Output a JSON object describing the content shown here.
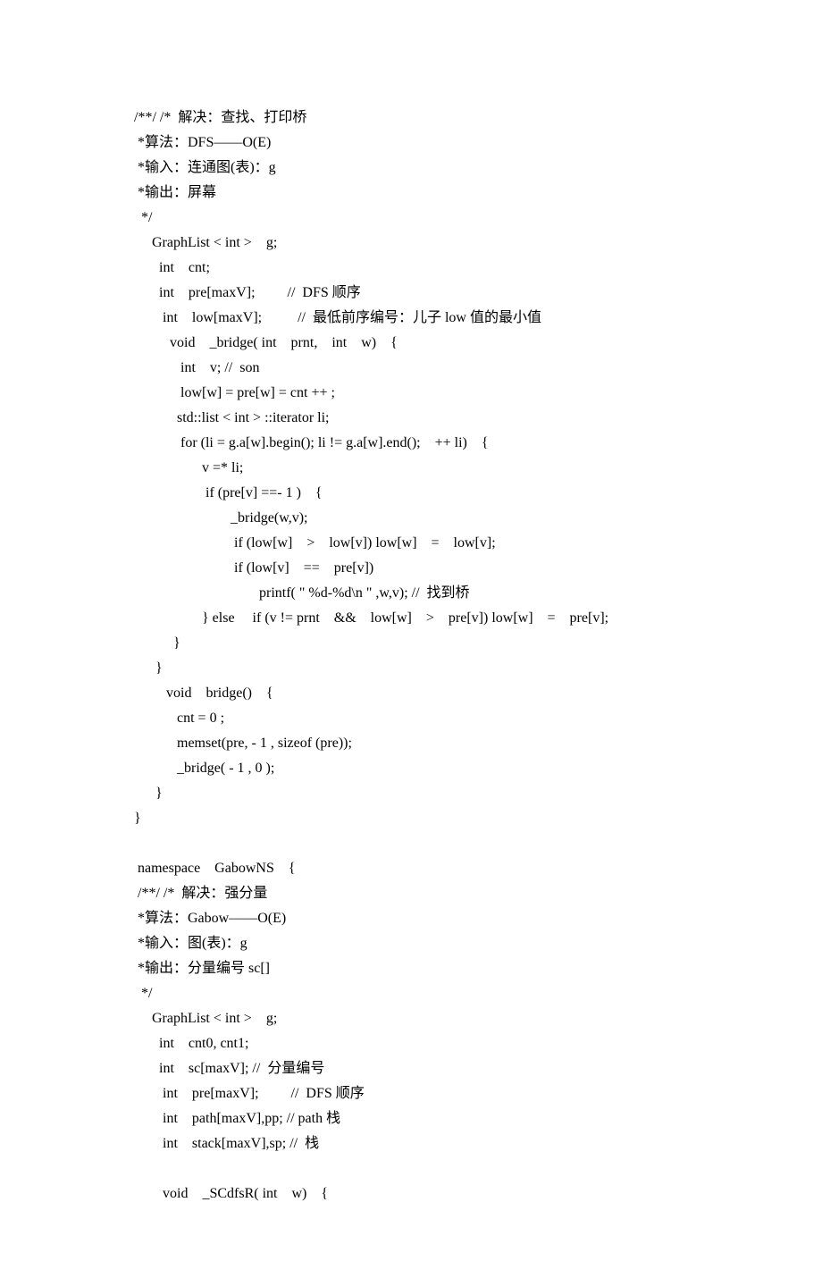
{
  "lines": [
    "/**/ /*  解决：查找、打印桥",
    " *算法：DFS——O(E)",
    " *输入：连通图(表)：g",
    " *输出：屏幕",
    "  */ ",
    "     GraphList < int >    g;",
    "       int    cnt;",
    "       int    pre[maxV];         //  DFS 顺序 ",
    "        int    low[maxV];          //  最低前序编号：儿子 low 值的最小值 ",
    "          void    _bridge( int    prnt,    int    w)    {",
    "             int    v; //  son",
    "             low[w] = pre[w] = cnt ++ ;",
    "            std::list < int > ::iterator li;",
    "             for (li = g.a[w].begin(); li != g.a[w].end();    ++ li)    {",
    "                   v =* li;",
    "                    if (pre[v] ==- 1 )    {",
    "                           _bridge(w,v);",
    "                            if (low[w]    >    low[v]) low[w]    =    low[v];",
    "                            if (low[v]    ==    pre[v])",
    "                                   printf( \" %d-%d\\n \" ,w,v); //  找到桥",
    "                   } else     if (v != prnt    &&    low[w]    >    pre[v]) low[w]    =    pre[v];",
    "           } ",
    "      } ",
    "         void    bridge()    {",
    "            cnt = 0 ;",
    "            memset(pre, - 1 , sizeof (pre));",
    "            _bridge( - 1 , 0 );",
    "      } ",
    "} ",
    "",
    " namespace    GabowNS    {",
    " /**/ /*  解决：强分量",
    " *算法：Gabow——O(E)",
    " *输入：图(表)：g",
    " *输出：分量编号 sc[]",
    "  */ ",
    "     GraphList < int >    g;",
    "       int    cnt0, cnt1;",
    "       int    sc[maxV]; //  分量编号 ",
    "        int    pre[maxV];         //  DFS 顺序 ",
    "        int    path[maxV],pp; // path 栈 ",
    "        int    stack[maxV],sp; //  栈",
    "      ",
    "        void    _SCdfsR( int    w)    {"
  ]
}
